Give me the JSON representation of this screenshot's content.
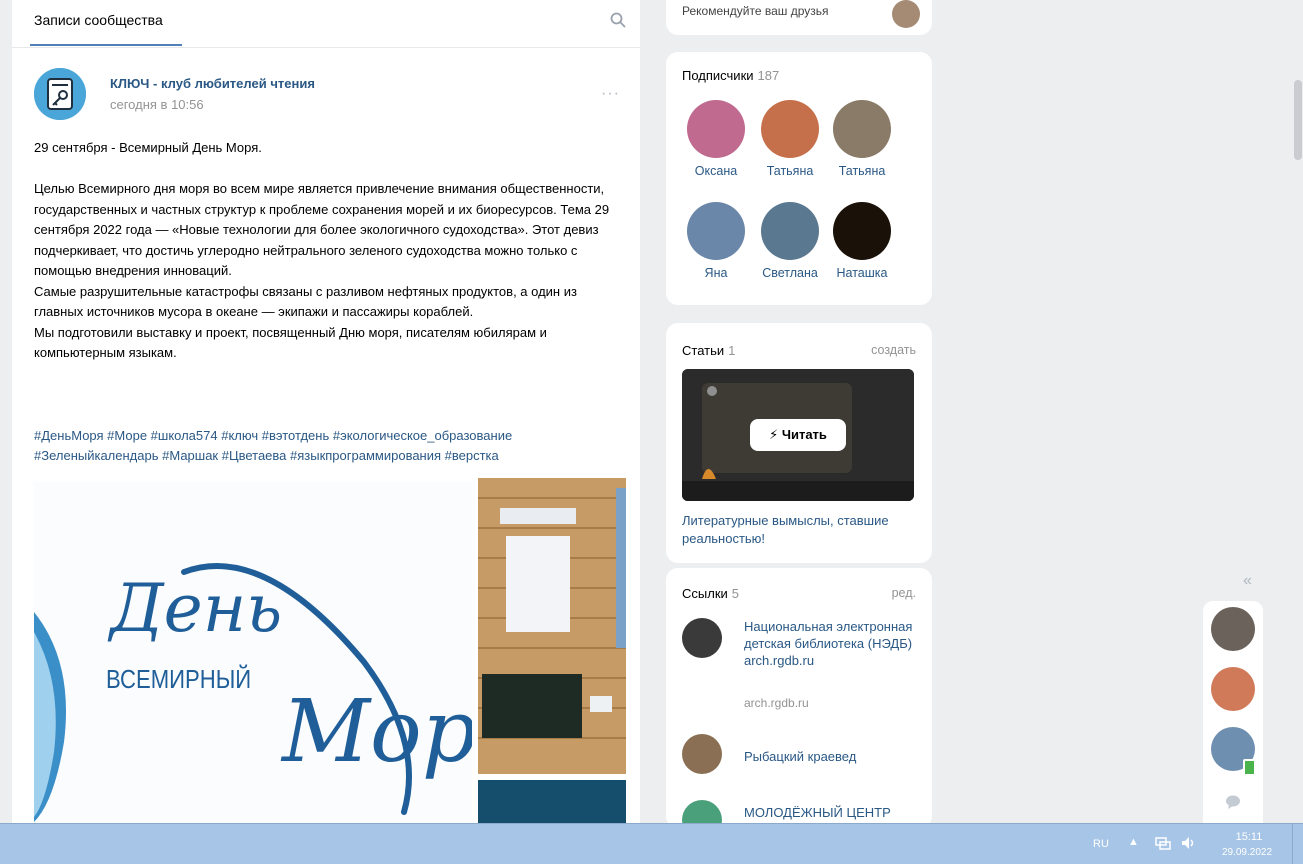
{
  "wall": {
    "tab_label": "Записи сообщества",
    "post": {
      "author": "КЛЮЧ - клуб любителей чтения",
      "time": "сегодня в 10:56",
      "more": "···",
      "text": "29 сентября - Всемирный День Моря.\n\nЦелью Всемирного дня моря во всем мире является привлечение внимания общественности, государственных и частных структур к проблеме сохранения морей и их биоресурсов. Тема 29 сентября 2022 года — «Новые технологии для более экологичного судоходства». Этот девиз подчеркивает, что достичь углеродно нейтрального зеленого судоходства можно только с помощью внедрения инноваций.\nСамые разрушительные катастрофы связаны с разливом нефтяных продуктов, а один из главных источников мусора в океане — экипажи и пассажиры кораблей.\nМы подготовили выставку и проект, посвященный Дню моря, писателям юбилярам и компьютерным языкам.",
      "hashtags": "#ДеньМоря #Море #школа574 #ключ #вэтотдень #экологическое_образование #Зеленыйкалендарь #Маршак #Цветаева #языкпрограммирования #верстка",
      "image_text": {
        "den": "День",
        "vsemirny": "ВСЕМИРНЫЙ",
        "morya": "Моря"
      }
    }
  },
  "top_stub": {
    "text": "Рекомендуйте ваш друзья"
  },
  "subscribers": {
    "title": "Подписчики",
    "count": "187",
    "people": [
      {
        "name": "Оксана",
        "color": "#c06a8f"
      },
      {
        "name": "Татьяна",
        "color": "#c5704a"
      },
      {
        "name": "Татьяна",
        "color": "#8a7a68"
      },
      {
        "name": "Яна",
        "color": "#6a86a8"
      },
      {
        "name": "Светлана",
        "color": "#5a7890"
      },
      {
        "name": "Наташка",
        "color": "#1a1208"
      }
    ]
  },
  "articles": {
    "title": "Статьи",
    "count": "1",
    "action": "создать",
    "read_button": "Читать",
    "article_title": "Литературные вымыслы, ставшие реальностью!"
  },
  "links": {
    "title": "Ссылки",
    "count": "5",
    "action": "ред.",
    "items": [
      {
        "title": "Национальная электронная детская библиотека (НЭДБ) arch.rgdb.ru",
        "url": "arch.rgdb.ru",
        "color": "#3a3a3a"
      },
      {
        "title": "Рыбацкий краевед",
        "url": "",
        "color": "#8a6f55"
      },
      {
        "title": "МОЛОДЁЖНЫЙ ЦЕНТР",
        "url": "",
        "color": "#4aa07a"
      }
    ]
  },
  "sidebar": {
    "collapse": "«"
  },
  "taskbar": {
    "lang": "RU",
    "caret": "▲",
    "time": "15:11",
    "date": "29.09.2022"
  },
  "colors": {
    "link": "#2a5885",
    "muted": "#939393",
    "accent": "#5181b8",
    "taskbar": "#a7c5e6"
  }
}
